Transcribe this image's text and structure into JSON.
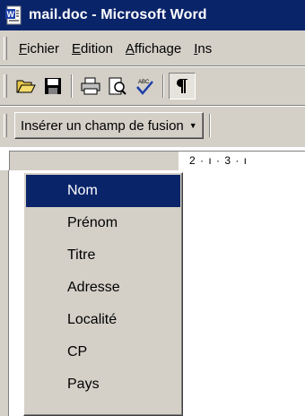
{
  "window": {
    "title": "mail.doc - Microsoft Word",
    "icon": "word-doc-icon"
  },
  "menubar": {
    "items": [
      {
        "label": "Fichier",
        "mnemonic": "F",
        "rest": "ichier"
      },
      {
        "label": "Edition",
        "mnemonic": "E",
        "rest": "dition"
      },
      {
        "label": "Affichage",
        "mnemonic": "A",
        "rest": "ffichage"
      },
      {
        "label": "Ins",
        "mnemonic": "I",
        "rest": "ns"
      }
    ]
  },
  "toolbar": {
    "buttons": [
      "open-icon",
      "save-icon",
      "print-icon",
      "print-preview-icon",
      "spelling-icon",
      "show-hide-paragraph-icon"
    ]
  },
  "mailmerge": {
    "insert_field_label": "Insérer un champ de fusion",
    "fields": [
      "Nom",
      "Prénom",
      "Titre",
      "Adresse",
      "Localité",
      "CP",
      "Pays"
    ],
    "selected": "Nom"
  },
  "ruler": {
    "text": "2 · ı · 3 · ı"
  },
  "colors": {
    "titlebar": "#0a246a",
    "face": "#d4d0c8",
    "highlight": "#0a246a"
  }
}
